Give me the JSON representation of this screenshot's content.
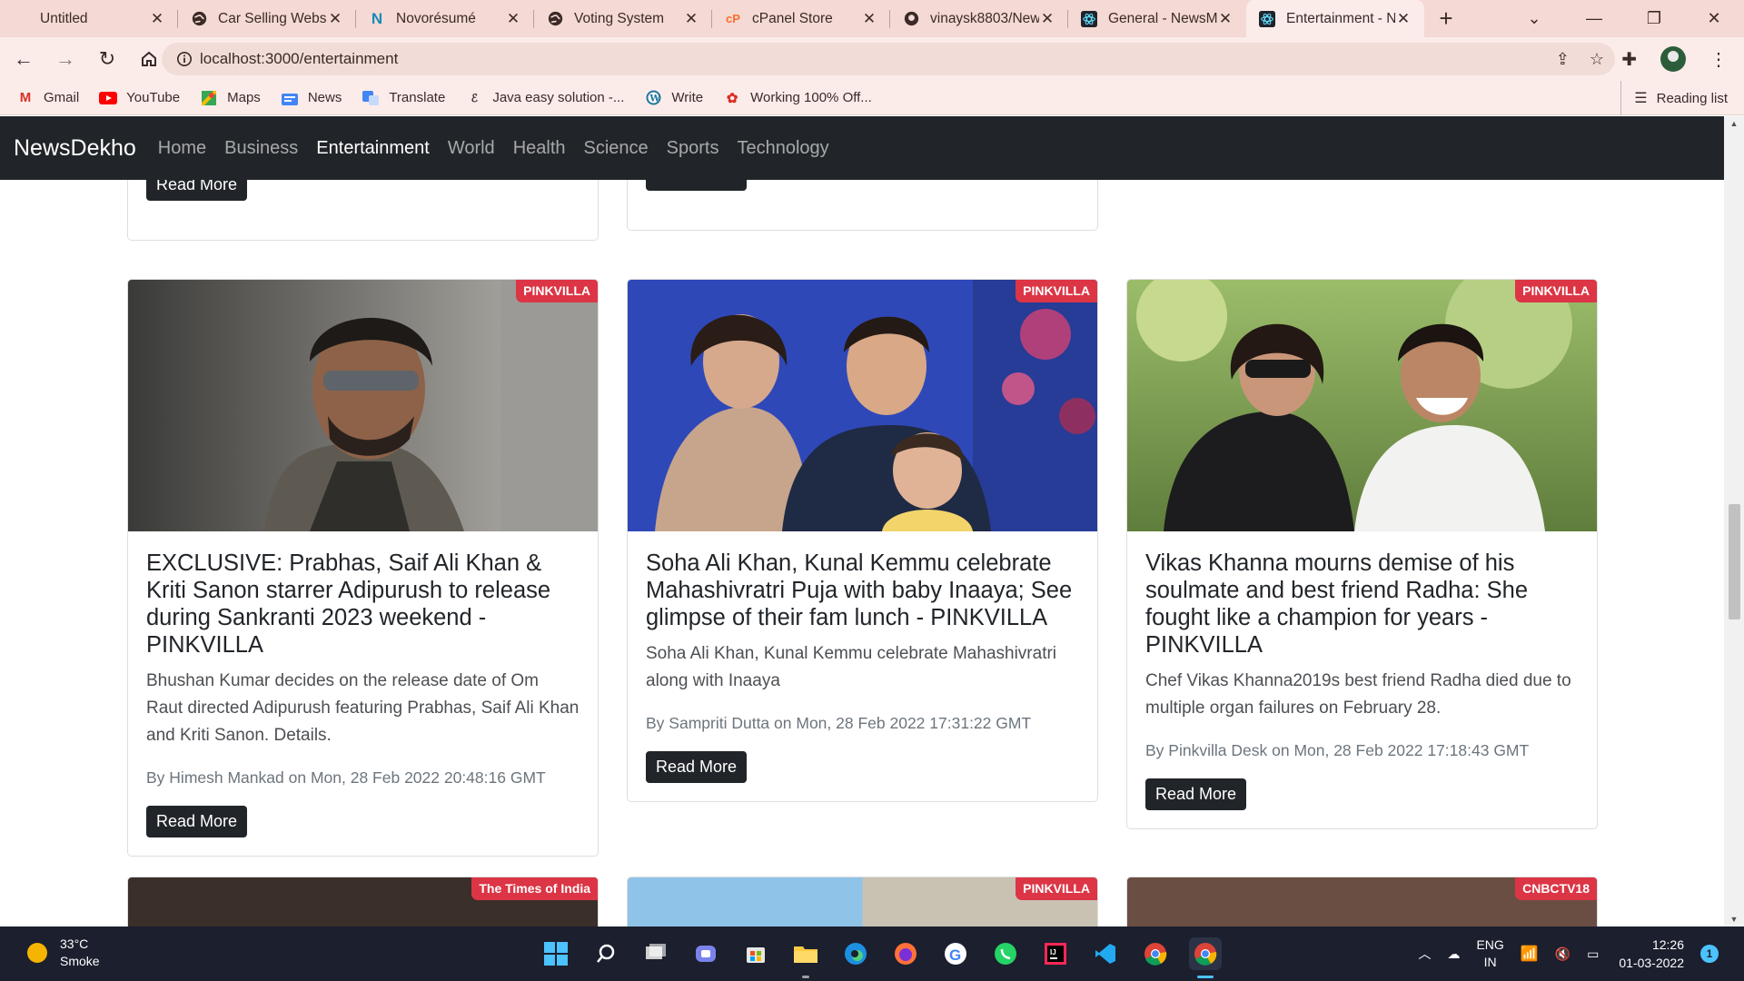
{
  "browser": {
    "tabs": [
      {
        "title": "Untitled",
        "favicon": "blank-icon"
      },
      {
        "title": "Car Selling Websi",
        "favicon": "globe-icon"
      },
      {
        "title": "Novorésumé",
        "favicon": "novoresume-icon"
      },
      {
        "title": "Voting System",
        "favicon": "globe-icon"
      },
      {
        "title": "cPanel Store",
        "favicon": "cpanel-icon"
      },
      {
        "title": "vinaysk8803/New",
        "favicon": "github-icon"
      },
      {
        "title": "General - NewsM",
        "favicon": "react-icon"
      },
      {
        "title": "Entertainment - N",
        "favicon": "react-icon"
      }
    ],
    "url": "localhost:3000/entertainment",
    "bookmarks": [
      {
        "label": "Gmail",
        "icon": "gmail-icon"
      },
      {
        "label": "YouTube",
        "icon": "youtube-icon"
      },
      {
        "label": "Maps",
        "icon": "maps-icon"
      },
      {
        "label": "News",
        "icon": "news-icon"
      },
      {
        "label": "Translate",
        "icon": "translate-icon"
      },
      {
        "label": "Java easy solution -...",
        "icon": "java-icon"
      },
      {
        "label": "Write",
        "icon": "wordpress-icon"
      },
      {
        "label": "Working 100% Off...",
        "icon": "offer-icon"
      }
    ],
    "reading_list": "Reading list"
  },
  "site": {
    "brand": "NewsDekho",
    "nav": [
      "Home",
      "Business",
      "Entertainment",
      "World",
      "Health",
      "Science",
      "Sports",
      "Technology"
    ],
    "active_nav": "Entertainment",
    "read_more": "Read More"
  },
  "cards": [
    {
      "source": "PINKVILLA",
      "title": "EXCLUSIVE: Prabhas, Saif Ali Khan & Kriti Sanon starrer Adipurush to release during Sankranti 2023 weekend - PINKVILLA",
      "description": "Bhushan Kumar decides on the release date of Om Raut directed Adipurush featuring Prabhas, Saif Ali Khan and Kriti Sanon. Details.",
      "author": "Himesh Mankad",
      "date": "Mon, 28 Feb 2022 20:48:16 GMT"
    },
    {
      "source": "PINKVILLA",
      "title": "Soha Ali Khan, Kunal Kemmu celebrate Mahashivratri Puja with baby Inaaya; See glimpse of their fam lunch - PINKVILLA",
      "description": "Soha Ali Khan, Kunal Kemmu celebrate Mahashivratri along with Inaaya",
      "author": "Sampriti Dutta",
      "date": "Mon, 28 Feb 2022 17:31:22 GMT"
    },
    {
      "source": "PINKVILLA",
      "title": "Vikas Khanna mourns demise of his soulmate and best friend Radha: She fought like a champion for years - PINKVILLA",
      "description": "Chef Vikas Khanna2019s best friend Radha died due to multiple organ failures on February 28.",
      "author": "Pinkvilla Desk",
      "date": "Mon, 28 Feb 2022 17:18:43 GMT"
    }
  ],
  "next_row_sources": [
    "The Times of India",
    "PINKVILLA",
    "CNBCTV18"
  ],
  "taskbar": {
    "temperature": "33°C",
    "weather": "Smoke",
    "lang1": "ENG",
    "lang2": "IN",
    "time": "12:26",
    "date": "01-03-2022",
    "notifications": "1"
  }
}
